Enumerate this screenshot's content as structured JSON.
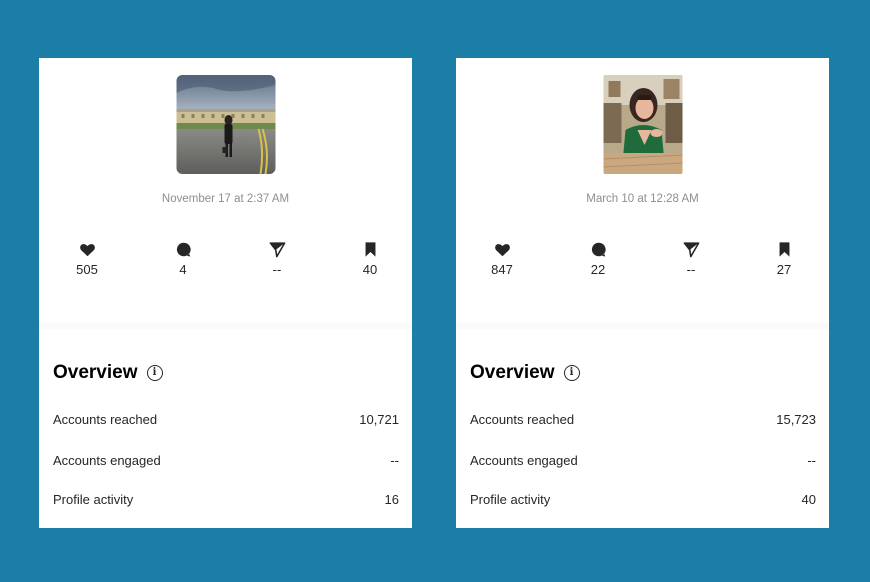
{
  "posts": [
    {
      "thumbnail_icon": "photo-woman-street-icon",
      "date": "November 17 at 2:37 AM",
      "stats": {
        "likes": "505",
        "comments": "4",
        "shares": "--",
        "saves": "40"
      },
      "overview": {
        "title": "Overview",
        "accounts_reached_label": "Accounts reached",
        "accounts_reached_value": "10,721",
        "accounts_engaged_label": "Accounts engaged",
        "accounts_engaged_value": "--",
        "profile_activity_label": "Profile activity",
        "profile_activity_value": "16"
      }
    },
    {
      "thumbnail_icon": "photo-woman-restaurant-icon",
      "date": "March 10 at 12:28 AM",
      "stats": {
        "likes": "847",
        "comments": "22",
        "shares": "--",
        "saves": "27"
      },
      "overview": {
        "title": "Overview",
        "accounts_reached_label": "Accounts reached",
        "accounts_reached_value": "15,723",
        "accounts_engaged_label": "Accounts engaged",
        "accounts_engaged_value": "--",
        "profile_activity_label": "Profile activity",
        "profile_activity_value": "40"
      }
    }
  ],
  "colors": {
    "background": "#1a7ea7",
    "card": "#ffffff",
    "muted_text": "#8e8e8e",
    "text": "#262626"
  }
}
